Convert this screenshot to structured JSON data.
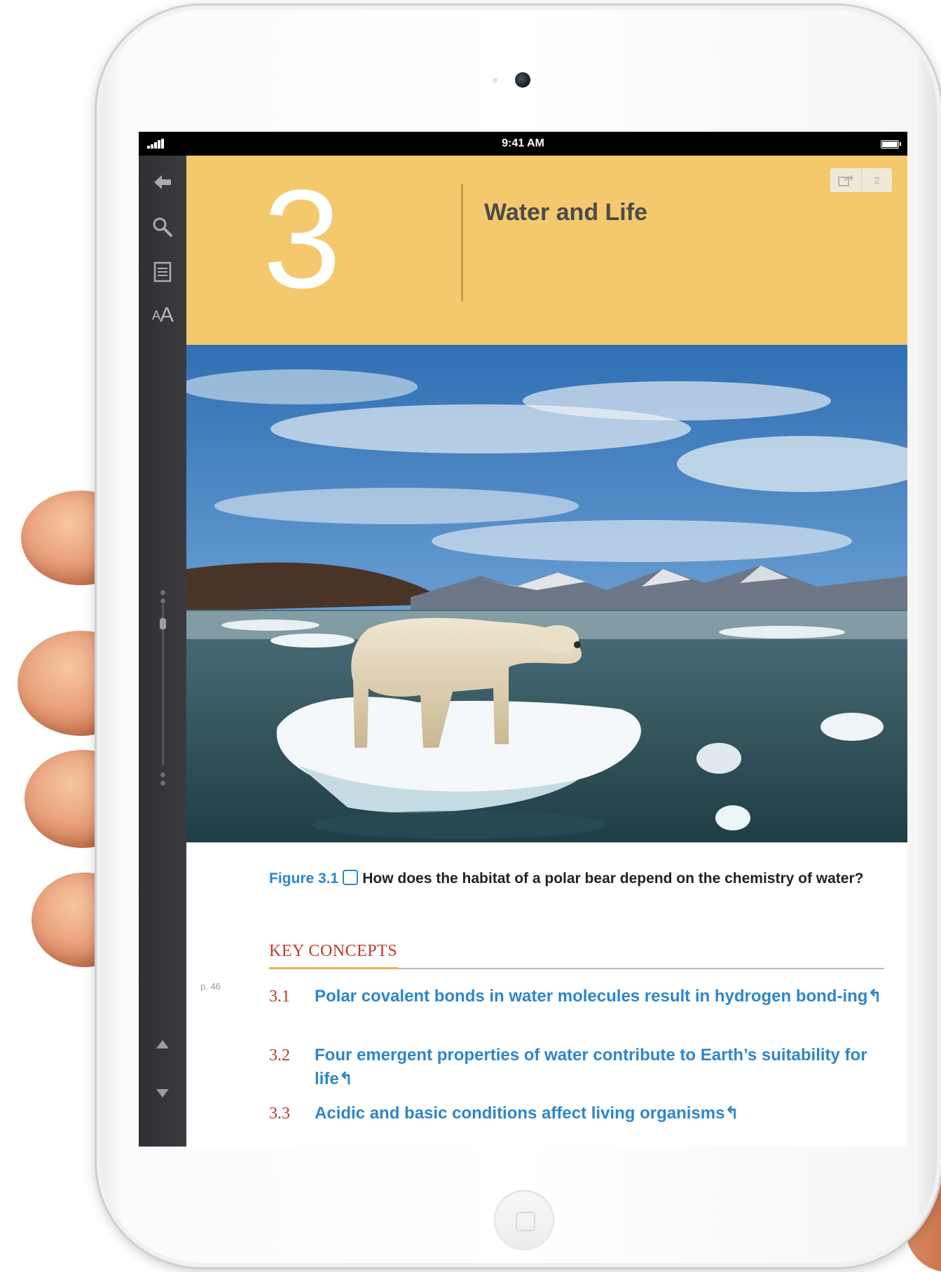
{
  "status_bar": {
    "time": "9:41 AM"
  },
  "header": {
    "chapter_number": "3",
    "chapter_title": "Water and Life",
    "share_count": "2"
  },
  "sidebar": {
    "icons": [
      "back-arrow-icon",
      "search-icon",
      "table-of-contents-icon",
      "text-size-icon"
    ],
    "text_size_label": "A"
  },
  "figure": {
    "label": "Figure 3.1",
    "question": "How does the habitat of a polar bear depend on the chemistry of water?"
  },
  "key_concepts": {
    "title": "KEY CONCEPTS",
    "page_ref": "p. 46",
    "items": [
      {
        "number": "3.1",
        "text": "Polar covalent bonds in water molecules result in hydrogen bond-ing"
      },
      {
        "number": "3.2",
        "text": "Four emergent properties of water contribute to Earth’s suitability for life"
      },
      {
        "number": "3.3",
        "text": "Acidic and basic conditions affect living organisms"
      }
    ]
  },
  "colors": {
    "header_yellow": "#f4c96d",
    "link_blue": "#2e86c8",
    "accent_red": "#c0392b"
  }
}
